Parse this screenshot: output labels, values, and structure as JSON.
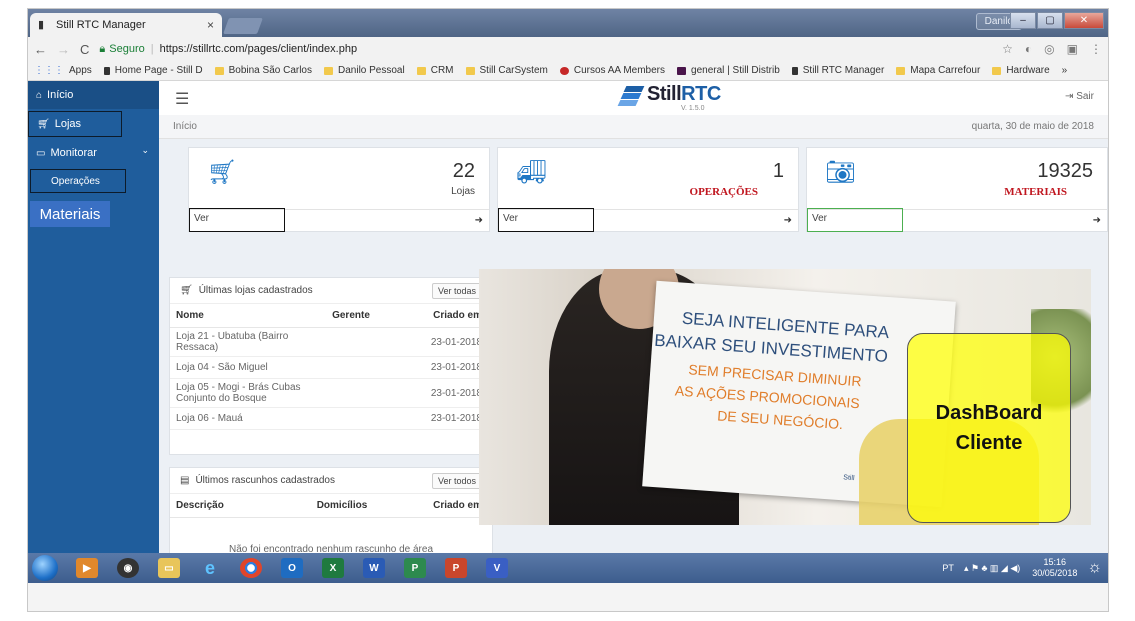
{
  "browser": {
    "tab_title": "Still RTC Manager",
    "tab_close": "×",
    "window_user": "Danilo",
    "win_minimize": "–",
    "win_maximize": "▢",
    "win_close": "✕",
    "secure_label": "Seguro",
    "url": "https://stillrtc.com/pages/client/index.php",
    "bookmarks": [
      "Apps",
      "Home Page - Still D",
      "Bobina São Carlos",
      "Danilo Pessoal",
      "CRM",
      "Still CarSystem",
      "Cursos AA Members",
      "general | Still Distrib",
      "Still RTC Manager",
      "Mapa Carrefour",
      "Hardware"
    ],
    "more_bookmarks": "»"
  },
  "sidebar": {
    "inicio": "Início",
    "lojas": "Lojas",
    "monitorar": "Monitorar",
    "operacoes": "Operações",
    "materiais": "Materiais"
  },
  "header": {
    "logo_still": "Still",
    "logo_rtc": "RTC",
    "version": "V. 1.5.0",
    "logout": "Sair"
  },
  "breadcrumb": {
    "current": "Início",
    "date": "quarta, 30 de maio de 2018"
  },
  "stats": [
    {
      "icon": "cart-icon",
      "value": "22",
      "label": "Lojas",
      "link": "Ver"
    },
    {
      "icon": "truck-icon",
      "value": "1",
      "label": "OPERAÇÕES",
      "link": "Ver"
    },
    {
      "icon": "camera-icon",
      "value": "19325",
      "label": "MATERIAIS",
      "link": "Ver"
    }
  ],
  "stores_panel": {
    "title": "Últimas lojas cadastrados",
    "button": "Ver todas",
    "columns": [
      "Nome",
      "Gerente",
      "Criado em"
    ],
    "rows": [
      {
        "name": "Loja 21 - Ubatuba (Bairro Ressaca)",
        "manager": "",
        "date": "23-01-2018"
      },
      {
        "name": "Loja 04 - São Miguel",
        "manager": "",
        "date": "23-01-2018"
      },
      {
        "name": "Loja 05 - Mogi - Brás Cubas Conjunto do Bosque",
        "manager": "",
        "date": "23-01-2018"
      },
      {
        "name": "Loja 06 - Mauá",
        "manager": "",
        "date": "23-01-2018"
      }
    ]
  },
  "drafts_panel": {
    "title": "Últimos rascunhos cadastrados",
    "button": "Ver todos",
    "columns": [
      "Descrição",
      "Domicílios",
      "Criado em"
    ],
    "empty_message": "Não foi encontrado nenhum rascunho de área"
  },
  "banner": {
    "line1": "SEJA INTELIGENTE PARA",
    "line2": "BAIXAR SEU INVESTIMENTO",
    "line3": "SEM PRECISAR DIMINUIR",
    "line4": "AS AÇÕES PROMOCIONAIS",
    "line5": "DE SEU NEGÓCIO.",
    "sign_logo": "Still",
    "callout_line1": "DashBoard",
    "callout_line2": "Cliente"
  },
  "taskbar": {
    "lang": "PT",
    "time": "15:16",
    "date": "30/05/2018"
  }
}
